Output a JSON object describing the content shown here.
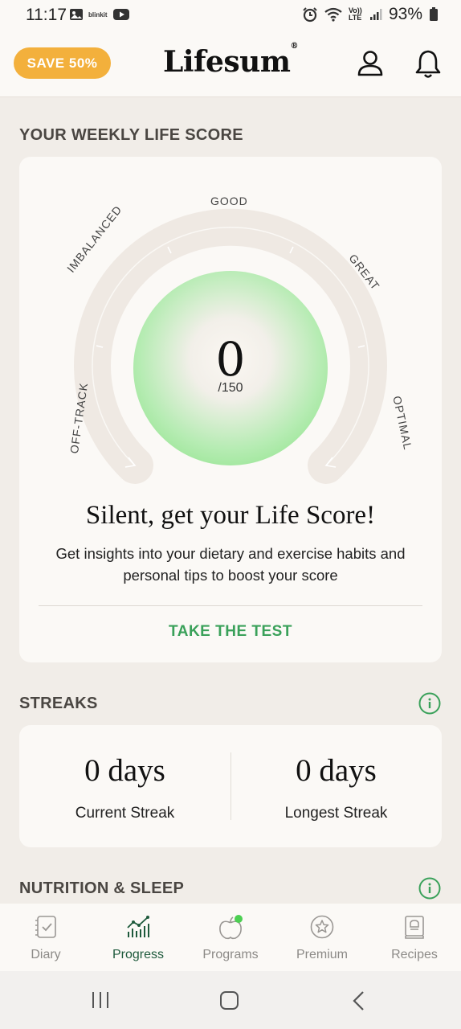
{
  "status_bar": {
    "time": "11:17",
    "left_icons": [
      "gallery-icon",
      "blinkit-icon",
      "youtube-icon"
    ],
    "blinkit_text": "blinkit",
    "battery": "93%",
    "network": "Vo)) LTE"
  },
  "header": {
    "save_label": "SAVE 50%",
    "logo": "Lifesum",
    "logo_mark": "®"
  },
  "life_score": {
    "section_title": "YOUR WEEKLY LIFE SCORE",
    "gauge_labels": {
      "good": "GOOD",
      "imbalanced": "IMBALANCED",
      "great": "GREAT",
      "off_track": "OFF-TRACK",
      "optimal": "OPTIMAL"
    },
    "score": "0",
    "score_max": "/150",
    "title": "Silent, get your Life Score!",
    "description": "Get insights into your dietary and exercise habits and personal tips to boost your score",
    "cta": "TAKE THE TEST"
  },
  "streaks": {
    "section_title": "STREAKS",
    "current_value": "0 days",
    "current_label": "Current Streak",
    "longest_value": "0 days",
    "longest_label": "Longest Streak"
  },
  "nutrition": {
    "section_title": "NUTRITION & SLEEP"
  },
  "bottom_nav": {
    "items": [
      {
        "label": "Diary",
        "icon": "diary-icon"
      },
      {
        "label": "Progress",
        "icon": "progress-chart-icon",
        "active": true
      },
      {
        "label": "Programs",
        "icon": "apple-icon",
        "badge": true
      },
      {
        "label": "Premium",
        "icon": "star-badge-icon"
      },
      {
        "label": "Recipes",
        "icon": "recipe-book-icon"
      }
    ]
  },
  "colors": {
    "accent_green": "#3aa15a",
    "save_orange": "#f3b03c",
    "active_nav": "#1e5a3c"
  }
}
